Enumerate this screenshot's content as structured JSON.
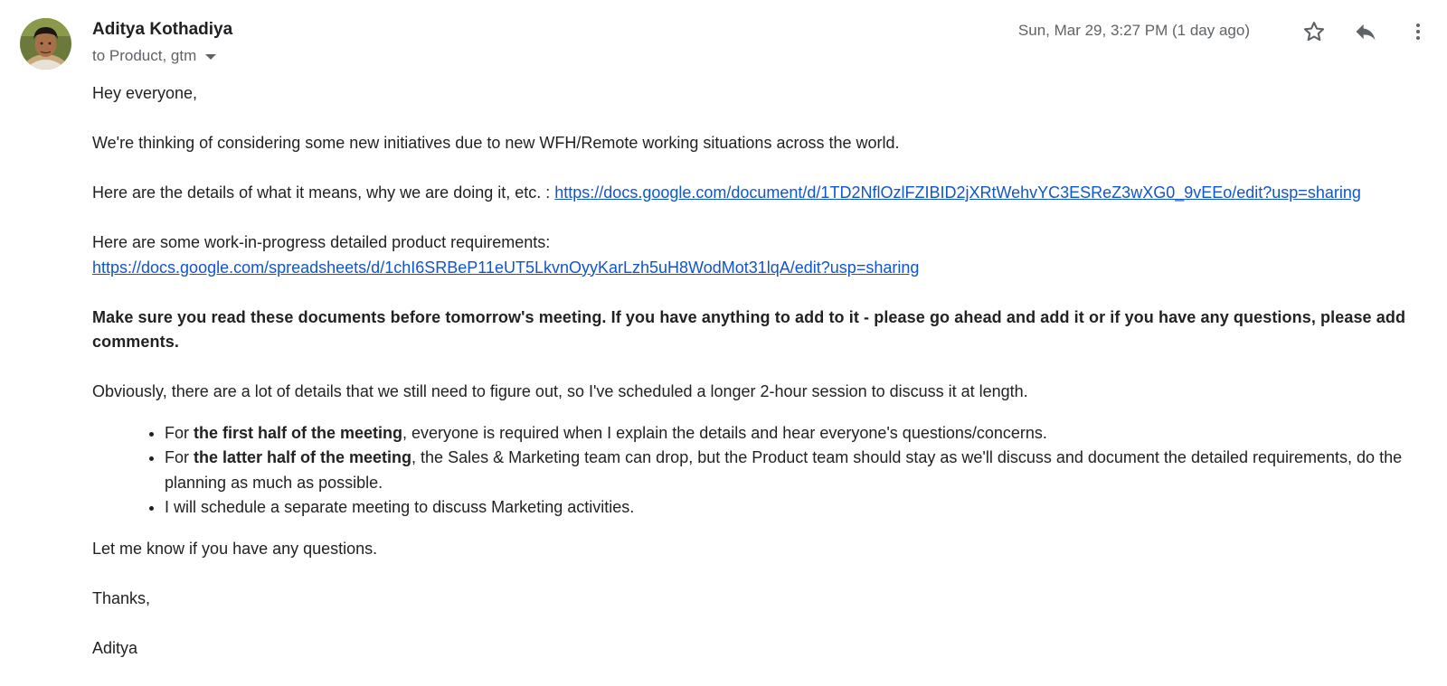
{
  "sender": {
    "name": "Aditya Kothadiya",
    "recipients": "to Product, gtm"
  },
  "timestamp": "Sun, Mar 29, 3:27 PM (1 day ago)",
  "icons": {
    "star": "star-icon",
    "reply": "reply-icon",
    "more": "more-vert-icon",
    "caret": "chevron-down-icon"
  },
  "body": {
    "greeting": "Hey everyone,",
    "intro": "We're thinking of considering some new initiatives due to new WFH/Remote working situations across the world.",
    "details_text": "Here are the details of what it means, why we are doing it, etc. : ",
    "details_link": "https://docs.google.com/document/d/1TD2NflOzlFZIBID2jXRtWehvYC3ESReZ3wXG0_9vEEo/edit?usp=sharing",
    "requirements_text": "Here are some work-in-progress detailed product requirements:",
    "requirements_link": "https://docs.google.com/spreadsheets/d/1chI6SRBeP11eUT5LkvnOyyKarLzh5uH8WodMot31lqA/edit?usp=sharing",
    "bold_notice": "Make sure you read these documents before tomorrow's meeting. If you have anything to add to it - please go ahead and add it or if you have any questions, please add comments.",
    "session_text": "Obviously, there are a lot of details that we still need to figure out, so I've scheduled a longer 2-hour session to discuss it at length.",
    "bullets": [
      {
        "prefix": "For ",
        "bold": "the first half of the meeting",
        "rest": ", everyone is required when I explain the details and hear everyone's questions/concerns."
      },
      {
        "prefix": "For ",
        "bold": "the latter half of the meeting",
        "rest": ", the Sales & Marketing team can drop, but the Product team should stay as we'll discuss and document the detailed requirements, do the planning as much as possible."
      },
      {
        "prefix": "",
        "bold": "",
        "rest": "I will schedule a separate meeting to discuss Marketing activities."
      }
    ],
    "closing": "Let me know if you have any questions.",
    "signoff": "Thanks,",
    "signature": "Aditya"
  },
  "colors": {
    "link": "#1155cc",
    "muted": "#5f6368",
    "text": "#222222"
  }
}
